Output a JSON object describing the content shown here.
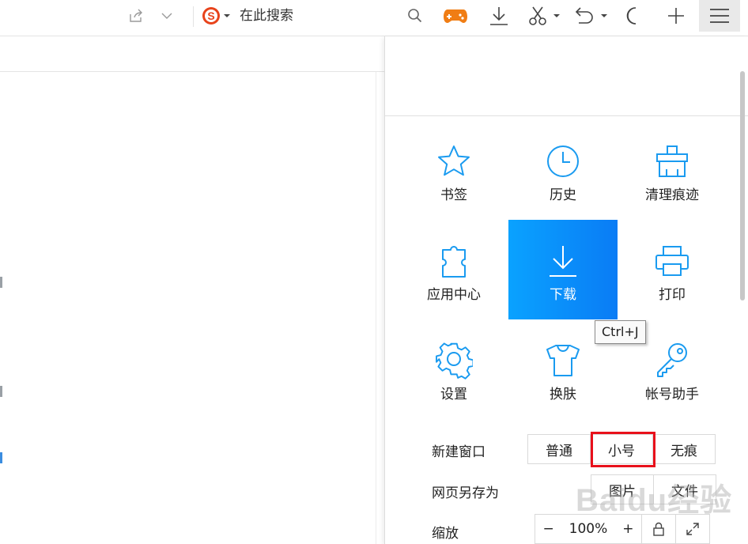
{
  "toolbar": {
    "search_engine_icon": "sogou-s-icon",
    "search_placeholder": "在此搜索",
    "icons": [
      "share-icon",
      "dropdown-icon",
      "sogou-s-icon",
      "search-icon",
      "gamepad-icon",
      "download-icon",
      "scissors-icon",
      "undo-icon",
      "moon-icon",
      "plus-icon",
      "menu-icon"
    ],
    "accent_colors": {
      "sogou": "#e8431b",
      "gamepad": "#f07d14",
      "menu_active_bg": "#e9e9e9"
    }
  },
  "panel": {
    "grid": [
      {
        "label": "书签",
        "icon": "star-icon"
      },
      {
        "label": "历史",
        "icon": "clock-icon"
      },
      {
        "label": "清理痕迹",
        "icon": "broom-icon"
      },
      {
        "label": "应用中心",
        "icon": "puzzle-icon"
      },
      {
        "label": "下载",
        "icon": "download-icon",
        "active": true
      },
      {
        "label": "打印",
        "icon": "printer-icon"
      },
      {
        "label": "设置",
        "icon": "gear-icon"
      },
      {
        "label": "换肤",
        "icon": "tshirt-icon"
      },
      {
        "label": "帐号助手",
        "icon": "key-icon"
      }
    ],
    "tooltip": "Ctrl+J",
    "new_window": {
      "label": "新建窗口",
      "options": [
        "普通",
        "小号",
        "无痕"
      ],
      "highlighted": "小号"
    },
    "save_as": {
      "label": "网页另存为",
      "options": [
        "图片",
        "文件"
      ]
    },
    "zoom": {
      "label": "缩放",
      "minus": "−",
      "value": "100%",
      "plus": "+"
    },
    "accent_color": "#0a8ef8",
    "highlight_color": "#e8101b"
  },
  "watermark": "Baidu经验"
}
